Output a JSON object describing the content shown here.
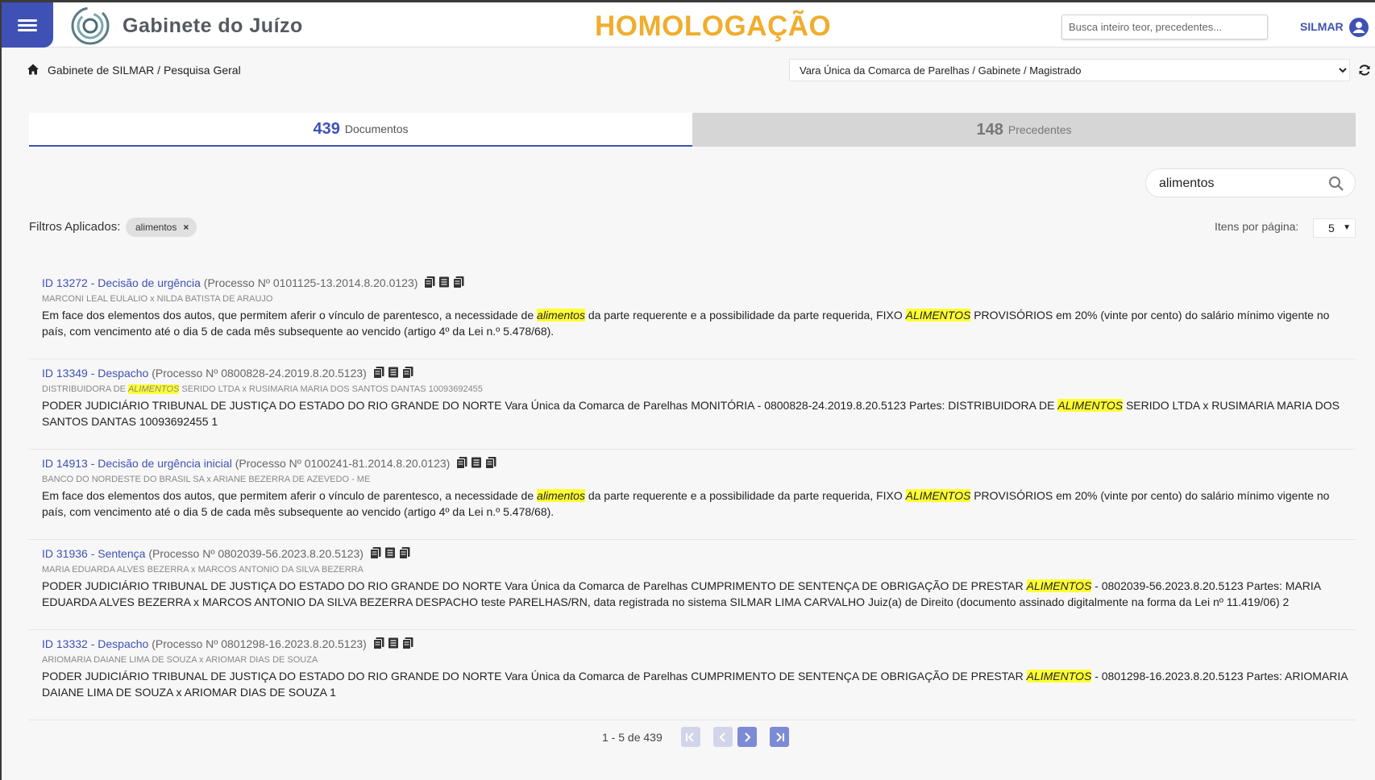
{
  "header": {
    "app_title": "Gabinete do Juízo",
    "environment": "HOMOLOGAÇÃO",
    "search_placeholder": "Busca inteiro teor, precedentes...",
    "user_name": "SILMAR"
  },
  "breadcrumb": "Gabinete de SILMAR / Pesquisa Geral",
  "org_select": {
    "selected": "Vara Única da Comarca de Parelhas / Gabinete / Magistrado"
  },
  "tabs": [
    {
      "count": "439",
      "label": "Documentos",
      "active": true
    },
    {
      "count": "148",
      "label": "Precedentes",
      "active": false
    }
  ],
  "filter_search": {
    "value": "alimentos"
  },
  "filters": {
    "label": "Filtros Aplicados:",
    "chips": [
      "alimentos"
    ]
  },
  "items_per_page": {
    "label": "Itens por página:",
    "value": "5"
  },
  "results": [
    {
      "id": "ID 13272 - Decisão de urgência",
      "process": "(Processo Nº 0101125-13.2014.8.20.0123)",
      "parties": [
        {
          "t": "MARCONI LEAL EULALIO x NILDA BATISTA DE ARAUJO"
        }
      ],
      "snippet": [
        {
          "t": "Em face dos elementos dos autos, que permitem aferir o vínculo de parentesco, a necessidade de "
        },
        {
          "t": "alimentos",
          "hl": true
        },
        {
          "t": " da parte requerente e a possibilidade da parte requerida, FIXO "
        },
        {
          "t": "ALIMENTOS",
          "hl": true
        },
        {
          "t": " PROVISÓRIOS em 20% (vinte por cento) do salário mínimo vigente no país, com vencimento até o dia 5 de cada mês subsequente ao vencido (artigo 4º da Lei n.º 5.478/68)."
        }
      ]
    },
    {
      "id": "ID 13349 - Despacho",
      "process": "(Processo Nº 0800828-24.2019.8.20.5123)",
      "parties": [
        {
          "t": "DISTRIBUIDORA DE "
        },
        {
          "t": "ALIMENTOS",
          "hl": true
        },
        {
          "t": " SERIDO LTDA x RUSIMARIA MARIA DOS SANTOS DANTAS 10093692455"
        }
      ],
      "snippet": [
        {
          "t": "PODER JUDICIÁRIO TRIBUNAL DE JUSTIÇA DO ESTADO DO RIO GRANDE DO NORTE Vara Única da Comarca de Parelhas MONITÓRIA - 0800828-24.2019.8.20.5123 Partes: DISTRIBUIDORA DE "
        },
        {
          "t": "ALIMENTOS",
          "hl": true
        },
        {
          "t": " SERIDO LTDA x RUSIMARIA MARIA DOS SANTOS DANTAS 10093692455 1"
        }
      ]
    },
    {
      "id": "ID 14913 - Decisão de urgência inicial",
      "process": "(Processo Nº 0100241-81.2014.8.20.0123)",
      "parties": [
        {
          "t": "BANCO DO NORDESTE DO BRASIL SA x ARIANE BEZERRA DE AZEVEDO - ME"
        }
      ],
      "snippet": [
        {
          "t": "Em face dos elementos dos autos, que permitem aferir o vínculo de parentesco, a necessidade de "
        },
        {
          "t": "alimentos",
          "hl": true
        },
        {
          "t": " da parte requerente e a possibilidade da parte requerida, FIXO "
        },
        {
          "t": "ALIMENTOS",
          "hl": true
        },
        {
          "t": " PROVISÓRIOS em 20% (vinte por cento) do salário mínimo vigente no país, com vencimento até o dia 5 de cada mês subsequente ao vencido (artigo 4º da Lei n.º 5.478/68)."
        }
      ]
    },
    {
      "id": "ID 31936 - Sentença",
      "process": "(Processo Nº 0802039-56.2023.8.20.5123)",
      "parties": [
        {
          "t": "MARIA EDUARDA ALVES BEZERRA x MARCOS ANTONIO DA SILVA BEZERRA"
        }
      ],
      "snippet": [
        {
          "t": "PODER JUDICIÁRIO TRIBUNAL DE JUSTIÇA DO ESTADO DO RIO GRANDE DO NORTE Vara Única da Comarca de Parelhas CUMPRIMENTO DE SENTENÇA DE OBRIGAÇÃO DE PRESTAR "
        },
        {
          "t": "ALIMENTOS",
          "hl": true
        },
        {
          "t": " - 0802039-56.2023.8.20.5123 Partes: MARIA EDUARDA ALVES BEZERRA x MARCOS ANTONIO DA SILVA BEZERRA DESPACHO teste PARELHAS/RN, data registrada no sistema SILMAR LIMA CARVALHO Juiz(a) de Direito (documento assinado digitalmente na forma da Lei nº 11.419/06) 2"
        }
      ]
    },
    {
      "id": "ID 13332 - Despacho",
      "process": "(Processo Nº 0801298-16.2023.8.20.5123)",
      "parties": [
        {
          "t": "ARIOMARIA DAIANE LIMA DE SOUZA x ARIOMAR DIAS DE SOUZA"
        }
      ],
      "snippet": [
        {
          "t": "PODER JUDICIÁRIO TRIBUNAL DE JUSTIÇA DO ESTADO DO RIO GRANDE DO NORTE Vara Única da Comarca de Parelhas CUMPRIMENTO DE SENTENÇA DE OBRIGAÇÃO DE PRESTAR "
        },
        {
          "t": "ALIMENTOS",
          "hl": true
        },
        {
          "t": " - 0801298-16.2023.8.20.5123 Partes: ARIOMARIA DAIANE LIMA DE SOUZA x ARIOMAR DIAS DE SOUZA 1"
        }
      ]
    }
  ],
  "pagination": {
    "range": "1 - 5 de 439",
    "buttons": [
      {
        "icon": "first-page-icon",
        "enabled": false
      },
      {
        "icon": "previous-page-icon",
        "enabled": false
      },
      {
        "icon": "next-page-icon",
        "enabled": true
      },
      {
        "icon": "last-page-icon",
        "enabled": true
      }
    ]
  },
  "colors": {
    "primary": "#3f51b5",
    "environment": "#f0ad2e",
    "highlight": "#ffff33"
  }
}
